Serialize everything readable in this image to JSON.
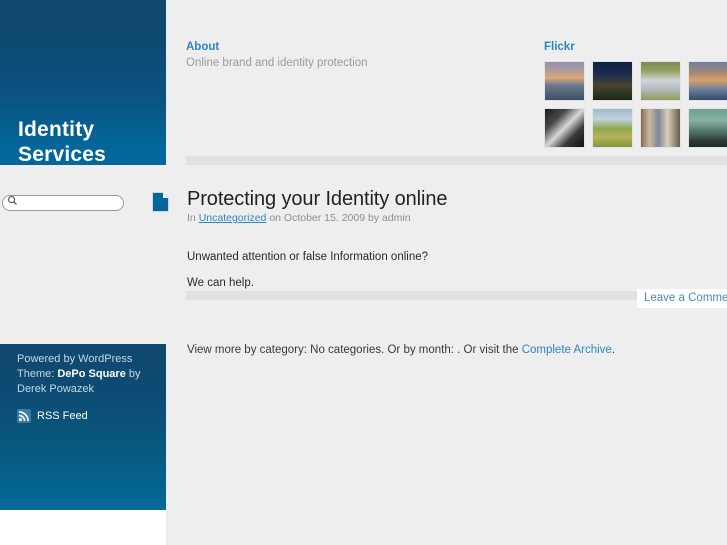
{
  "site": {
    "title_line1": "Identity",
    "title_line2": "Services"
  },
  "search": {
    "value": "",
    "placeholder": ""
  },
  "header": {
    "about": {
      "link_label": "About",
      "tagline": "Online brand and identity protection"
    },
    "flickr": {
      "title": "Flickr",
      "thumbnails": [
        {
          "name": "flickr-thumb-1",
          "alt": "coastal sunset"
        },
        {
          "name": "flickr-thumb-2",
          "alt": "dark seascape at dusk"
        },
        {
          "name": "flickr-thumb-3",
          "alt": "white umbrellas on grass"
        },
        {
          "name": "flickr-thumb-4",
          "alt": "sunset over water"
        },
        {
          "name": "flickr-thumb-5",
          "alt": "black and white portrait"
        },
        {
          "name": "flickr-thumb-6",
          "alt": "green field and sky"
        },
        {
          "name": "flickr-thumb-7",
          "alt": "store shelves interior"
        },
        {
          "name": "flickr-thumb-8",
          "alt": "teal city skyline"
        }
      ]
    }
  },
  "post": {
    "title": "Protecting your Identity online",
    "meta": {
      "prefix": "In ",
      "category": "Uncategorized",
      "middle": " on October 15. 2009 by ",
      "author": "admin"
    },
    "paragraphs": [
      "Unwanted attention or false Information online?",
      "We can help."
    ],
    "comment_link": "Leave a Comment"
  },
  "archive": {
    "prefix": "View more by category: No categories. Or by month: . Or visit the ",
    "link": "Complete Archive",
    "suffix": "."
  },
  "sidebar_footer": {
    "powered_by": "Powered by WordPress",
    "theme_prefix": "Theme: ",
    "theme_name": "DePo Square",
    "theme_by": " by",
    "theme_author": "Derek Powazek",
    "rss_label": "RSS Feed"
  },
  "colors": {
    "sidebar_blue_top": "#10486f",
    "sidebar_blue_bottom": "#03679b",
    "link_blue": "#2e86c0",
    "page_bg": "#eeeeee"
  }
}
